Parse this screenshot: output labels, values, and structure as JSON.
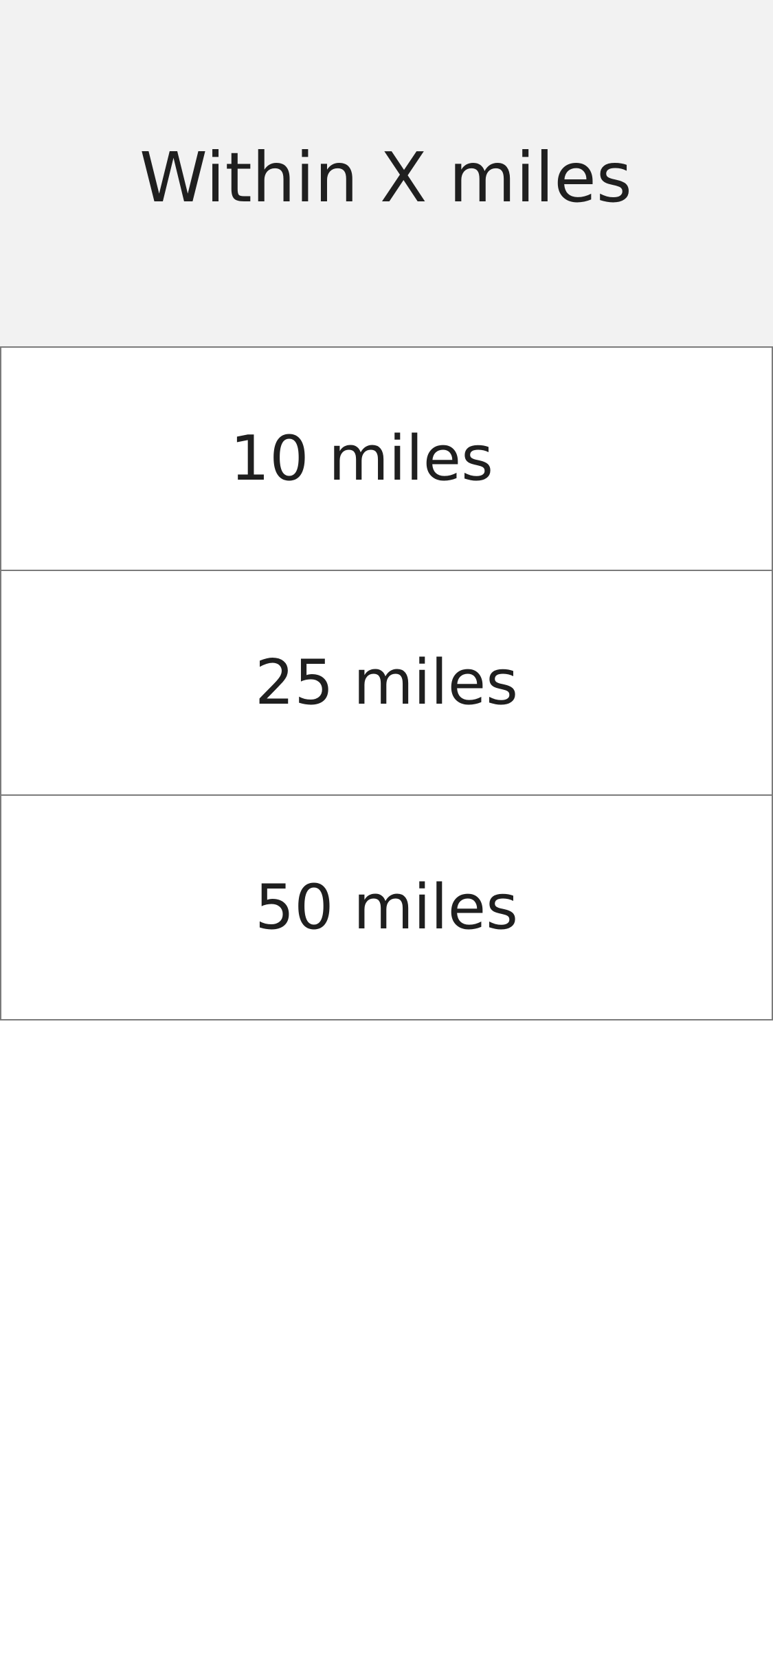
{
  "header": {
    "title": "Within X miles"
  },
  "options": [
    {
      "label": "10 miles"
    },
    {
      "label": "25 miles"
    },
    {
      "label": "50 miles"
    }
  ],
  "colors": {
    "header_background": "#f2f2f2",
    "border": "#7a7a7a",
    "text": "#1f1f1f",
    "background": "#ffffff"
  }
}
